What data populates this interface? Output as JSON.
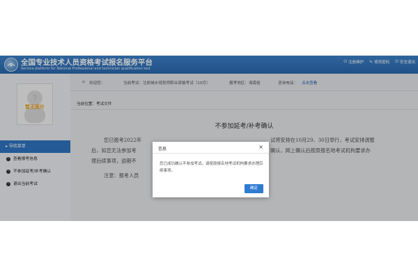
{
  "header": {
    "title": "全国专业技术人员资格考试报名服务平台",
    "subtitle": "Service platform for National Professional and technician qualification test",
    "links": [
      {
        "icon": "logout-icon",
        "label": "注册维护"
      },
      {
        "icon": "edit-icon",
        "label": "修改密码"
      },
      {
        "icon": "power-icon",
        "label": "安全退出"
      }
    ]
  },
  "sidebar": {
    "photo_label": "暂无照片",
    "nav_title": "导航菜单",
    "items": [
      {
        "label": "查看报考信息"
      },
      {
        "label": "不参加延考/补考确认"
      },
      {
        "label": "退出当前考试"
      }
    ]
  },
  "infobar": {
    "welcome": "欢迎您：",
    "exam": "当前考试：注册城乡规划师职业资格考试（10月）",
    "region": "报考地区：海南省",
    "phone_label": "咨询电话：",
    "phone_link": "点击查看"
  },
  "content": {
    "breadcrumb": "当前位置：考试文件",
    "title": "不参加延考/补考确认",
    "line1a": "您已报考2022年",
    "line1b": "试将安排在10月29、30日举行，考试安排调整",
    "line2a": "后，如您无法参加考",
    "line2b": "确认，网上确认后按原报名地考试机构要求办",
    "line3a": "理后续事项，逾期不",
    "line4a": "注意：报考人员"
  },
  "dialog": {
    "title": "信息",
    "close": "×",
    "message": "您已成功确认不参加考试。请按原报名地考试机构要求办理后续事项。",
    "ok_label": "确定"
  },
  "colors": {
    "header_blue": "#2f74c0",
    "button_blue": "#2e7bd1",
    "photo_orange": "#e8a01e"
  }
}
